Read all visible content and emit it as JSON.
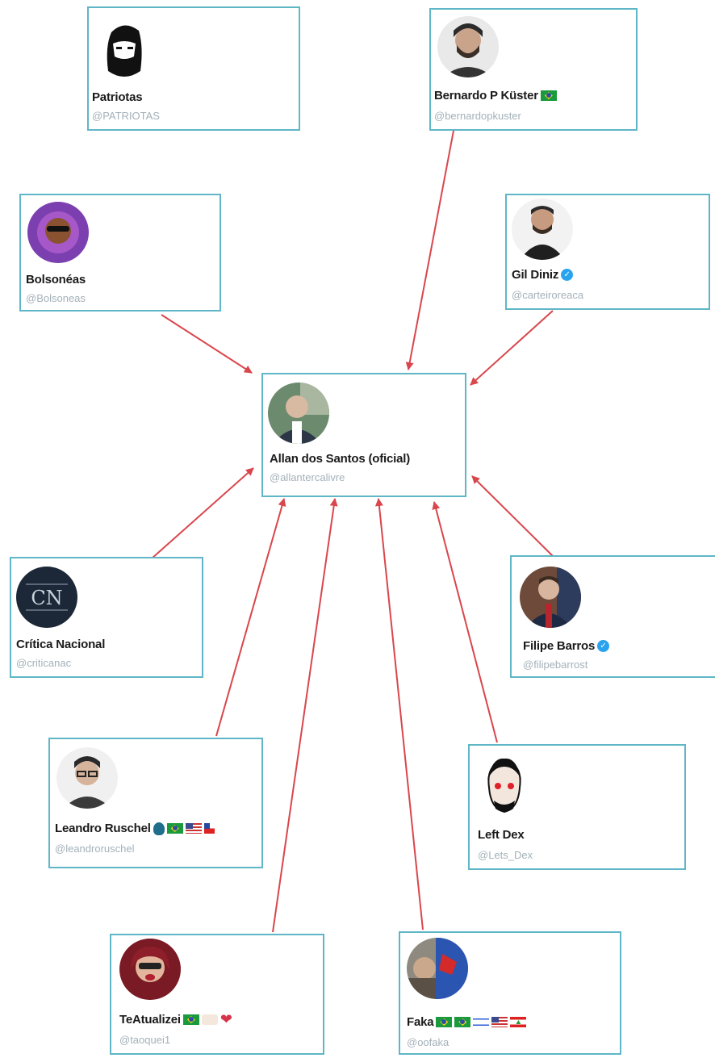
{
  "accounts": {
    "center": {
      "name": "Allan dos Santos (oficial)",
      "handle": "@allantercalivre"
    },
    "patriotas": {
      "name": "Patriotas",
      "handle": "@PATRIOTAS"
    },
    "kuster": {
      "name": "Bernardo P Küster",
      "handle": "@bernardopkuster"
    },
    "bolsoneas": {
      "name": "Bolsonéas",
      "handle": "@Bolsoneas"
    },
    "gil": {
      "name": "Gil Diniz",
      "handle": "@carteiroreaca"
    },
    "critica": {
      "name": "Crítica Nacional",
      "handle": "@criticanac",
      "logo_text": "CN"
    },
    "filipe": {
      "name": "Filipe Barros",
      "handle": "@filipebarrost"
    },
    "leandro": {
      "name": "Leandro Ruschel",
      "handle": "@leandroruschel"
    },
    "leftdex": {
      "name": "Left Dex",
      "handle": "@Lets_Dex"
    },
    "teatualizei": {
      "name": "TeAtualizei",
      "handle": "@taoquei1"
    },
    "faka": {
      "name": "Faka",
      "handle": "@oofaka"
    }
  },
  "colors": {
    "card_border": "#5fb6c6",
    "arrow": "#d9464c",
    "verified": "#2aa3ef"
  }
}
